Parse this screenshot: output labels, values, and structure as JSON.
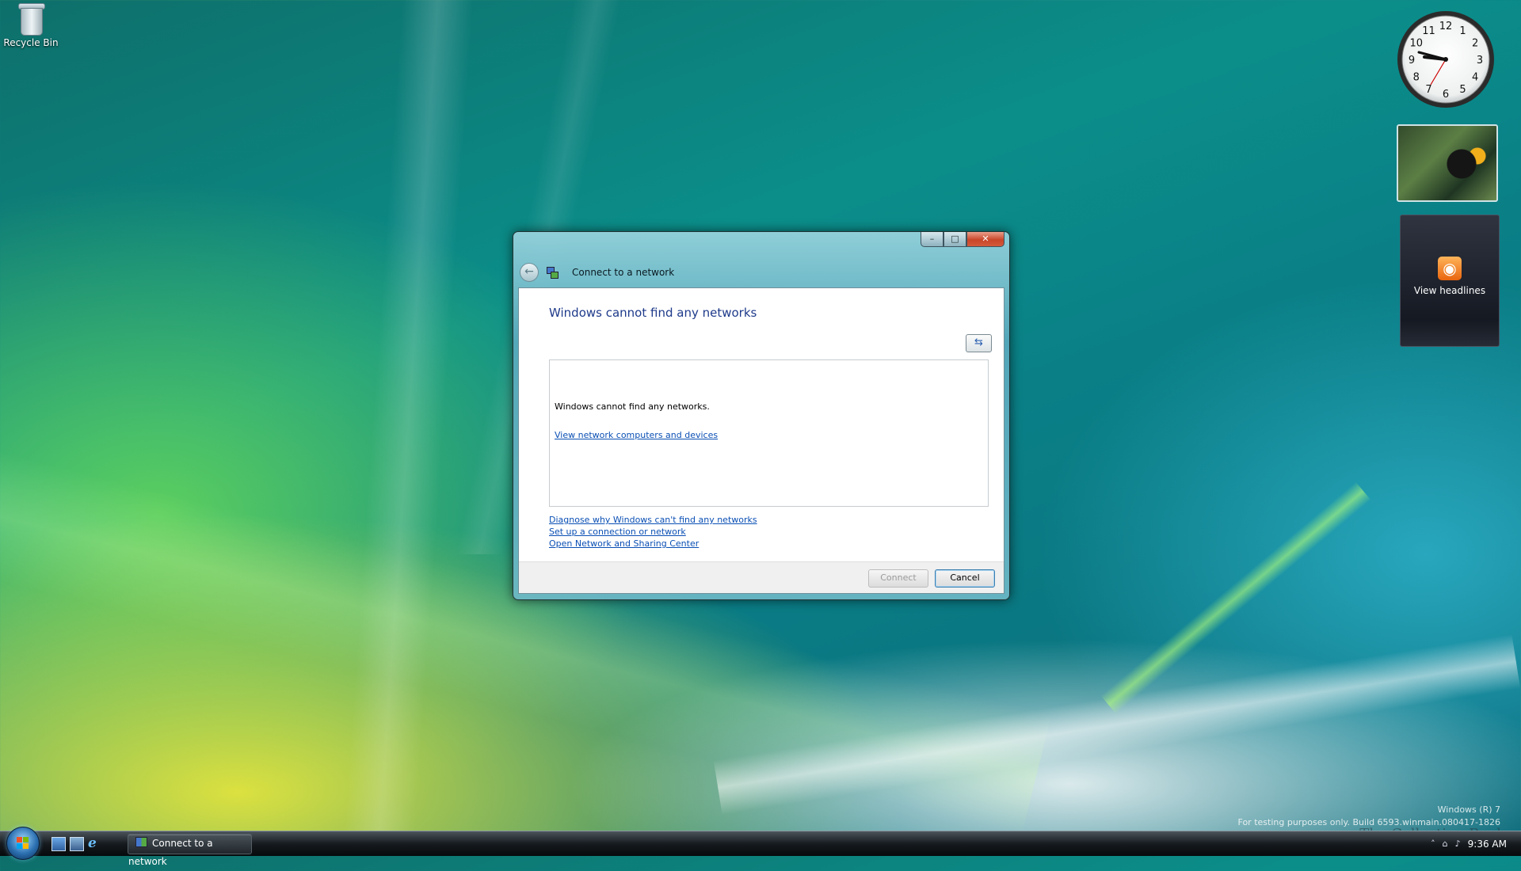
{
  "desktop": {
    "icons": [
      {
        "label": "Recycle Bin"
      }
    ]
  },
  "gadgets": {
    "clock": {
      "numerals": [
        "12",
        "1",
        "2",
        "3",
        "4",
        "5",
        "6",
        "7",
        "8",
        "9",
        "10",
        "11"
      ]
    },
    "feed": {
      "label": "View headlines"
    }
  },
  "dialog": {
    "title": "Connect to a network",
    "caption_buttons": {
      "minimize": "–",
      "maximize": "□",
      "close": "✕"
    },
    "heading": "Windows cannot find any networks",
    "refresh_glyph": "⇆",
    "list": {
      "message": "Windows cannot find any networks.",
      "link": "View network computers and devices"
    },
    "links": [
      "Diagnose why Windows can't find any networks",
      "Set up a connection or network",
      "Open Network and Sharing Center"
    ],
    "buttons": {
      "connect": "Connect",
      "cancel": "Cancel"
    }
  },
  "watermark": {
    "line1": "Windows (R) 7",
    "line2": "For testing purposes only. Build 6593.winmain.080417-1826",
    "book": "The Collection Book"
  },
  "taskbar": {
    "window_button": "Connect to a network",
    "tray": {
      "expand": "˄",
      "network": "⌂",
      "volume": "♪",
      "time": "9:36 AM"
    }
  },
  "colors": {
    "link": "#0a4fb4",
    "heading": "#1e3a8a",
    "close_button": "#c9462a",
    "rss": "#e8650e"
  }
}
